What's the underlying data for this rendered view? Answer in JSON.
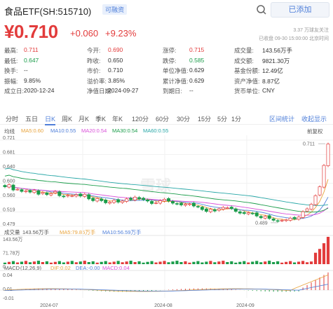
{
  "header": {
    "title": "食品ETF(SH:515710)",
    "tag": "可融资",
    "added_label": "已添加"
  },
  "quote": {
    "price": "¥0.710",
    "change": "+0.060",
    "change_pct": "+9.23%",
    "meta_line1": "3.37 万球友关注",
    "meta_line2": "已收盘 09-30 15:00:00 北京时间"
  },
  "stats": [
    [
      {
        "k": "最高:",
        "v": "0.711",
        "color": "red"
      },
      {
        "k": "今开:",
        "v": "0.690",
        "color": "red"
      },
      {
        "k": "涨停:",
        "v": "0.715",
        "color": "red"
      },
      {
        "k": "成交量:",
        "v": "143.56万手",
        "color": "normal"
      }
    ],
    [
      {
        "k": "最低:",
        "v": "0.647",
        "color": "green"
      },
      {
        "k": "昨收:",
        "v": "0.650",
        "color": "normal"
      },
      {
        "k": "跌停:",
        "v": "0.585",
        "color": "green"
      },
      {
        "k": "成交额:",
        "v": "9821.30万",
        "color": "normal"
      }
    ],
    [
      {
        "k": "换手:",
        "v": "--",
        "color": "normal"
      },
      {
        "k": "市价:",
        "v": "0.710",
        "color": "normal"
      },
      {
        "k": "单位净值:",
        "v": "0.629",
        "color": "normal"
      },
      {
        "k": "基金份额:",
        "v": "12.49亿",
        "color": "normal"
      }
    ],
    [
      {
        "k": "振幅:",
        "v": "9.85%",
        "color": "normal"
      },
      {
        "k": "溢价率:",
        "v": "3.85%",
        "color": "normal"
      },
      {
        "k": "累计净值:",
        "v": "0.629",
        "color": "normal"
      },
      {
        "k": "资产净值:",
        "v": "8.87亿",
        "color": "normal"
      }
    ],
    [
      {
        "k": "成立日:",
        "v": "2020-12-24",
        "color": "normal"
      },
      {
        "k": "净值日期:",
        "v": "2024-09-27",
        "color": "normal"
      },
      {
        "k": "到期日:",
        "v": "--",
        "color": "normal"
      },
      {
        "k": "货币单位:",
        "v": "CNY",
        "color": "normal"
      }
    ]
  ],
  "periods": [
    "分时",
    "五日",
    "日K",
    "周K",
    "月K",
    "季K",
    "年K",
    "120分",
    "60分",
    "30分",
    "15分",
    "5分",
    "1分"
  ],
  "active_period": "日K",
  "period_right": [
    "区间统计",
    "收起显示"
  ],
  "ma": {
    "label": "均线",
    "items": [
      {
        "text": "MA5:0.60",
        "color": "#e8a33c"
      },
      {
        "text": "MA10:0.55",
        "color": "#4f7fd9"
      },
      {
        "text": "MA20:0.54",
        "color": "#d94fd9"
      },
      {
        "text": "MA30:0.54",
        "color": "#1a9c4a"
      },
      {
        "text": "MA60:0.55",
        "color": "#26a6a6"
      }
    ],
    "adjust_label": "前复权"
  },
  "price_axis": [
    "0.721",
    "0.681",
    "0.640",
    "0.600",
    "0.560",
    "0.519",
    "0.479"
  ],
  "price_annotations": {
    "high": "0.711",
    "low": "0.489"
  },
  "volume": {
    "label": "成交量",
    "value": "143.56万手",
    "ma5": "MA5:79.85万手",
    "ma10": "MA10:56.59万手",
    "axis": [
      "143.56万",
      "71.78万",
      "0"
    ]
  },
  "macd": {
    "label": "MACD",
    "params": "(12,26,9)",
    "dif": "DIF:0.02",
    "dea": "DEA:-0.00",
    "macd": "MACD:0.04",
    "axis": [
      "0.04",
      "0.01",
      "-0.01"
    ]
  },
  "date_axis": [
    "2024-07",
    "2024-08",
    "2024-09"
  ],
  "chart_data": {
    "type": "candlestick",
    "close": [
      0.59,
      0.596,
      0.581,
      0.583,
      0.577,
      0.578,
      0.575,
      0.58,
      0.569,
      0.574,
      0.568,
      0.571,
      0.577,
      0.565,
      0.562,
      0.566,
      0.565,
      0.568,
      0.564,
      0.569,
      0.556,
      0.551,
      0.557,
      0.551,
      0.545,
      0.547,
      0.552,
      0.547,
      0.55,
      0.556,
      0.554,
      0.561,
      0.556,
      0.554,
      0.55,
      0.543,
      0.545,
      0.551,
      0.555,
      0.55,
      0.544,
      0.542,
      0.539,
      0.541,
      0.542,
      0.536,
      0.534,
      0.526,
      0.521,
      0.527,
      0.522,
      0.528,
      0.532,
      0.531,
      0.529,
      0.521,
      0.516,
      0.515,
      0.517,
      0.515,
      0.508,
      0.503,
      0.507,
      0.501,
      0.496,
      0.493,
      0.496,
      0.497,
      0.502,
      0.5,
      0.505,
      0.52,
      0.528,
      0.541,
      0.565,
      0.59,
      0.65,
      0.71
    ],
    "low_point": 0.489,
    "high_point": 0.711,
    "volume_axis_max": 143.56
  }
}
